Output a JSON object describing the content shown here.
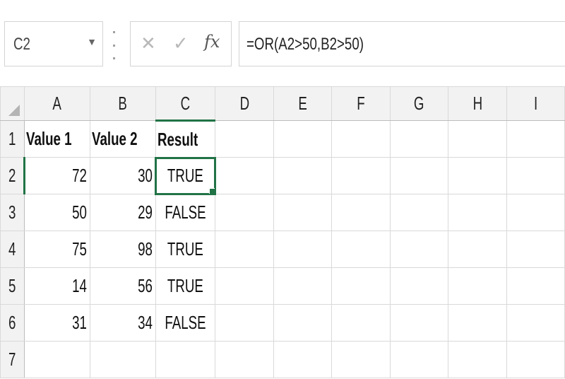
{
  "name_box": {
    "value": "C2"
  },
  "formula_bar": {
    "cancel_icon": "x-icon",
    "enter_icon": "check-icon",
    "fx_label": "fx",
    "formula": "=OR(A2>50,B2>50)"
  },
  "columns": [
    "A",
    "B",
    "C",
    "D",
    "E",
    "F",
    "G",
    "H",
    "I"
  ],
  "rows": [
    "1",
    "2",
    "3",
    "4",
    "5",
    "6",
    "7"
  ],
  "cells": {
    "r1": {
      "a": "Value 1",
      "b": "Value 2",
      "c": "Result"
    },
    "r2": {
      "a": "72",
      "b": "30",
      "c": "TRUE"
    },
    "r3": {
      "a": "50",
      "b": "29",
      "c": "FALSE"
    },
    "r4": {
      "a": "75",
      "b": "98",
      "c": "TRUE"
    },
    "r5": {
      "a": "14",
      "b": "56",
      "c": "TRUE"
    },
    "r6": {
      "a": "31",
      "b": "34",
      "c": "FALSE"
    }
  },
  "selected_cell": "C2",
  "colors": {
    "accent": "#217346",
    "header_bg": "#f2f2f2",
    "gridline": "#d9d9d9"
  }
}
